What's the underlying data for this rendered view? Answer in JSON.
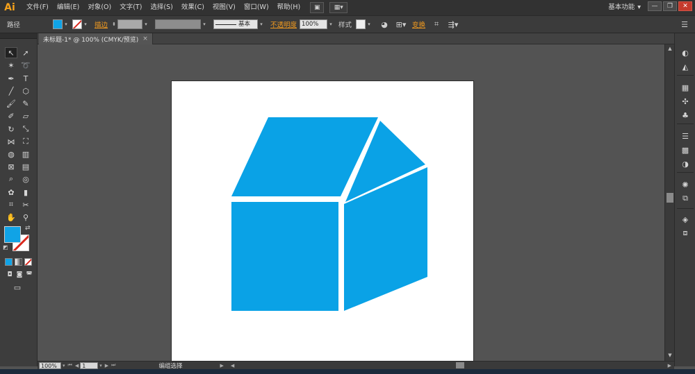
{
  "app": {
    "logo": "Ai"
  },
  "menu": [
    "文件(F)",
    "编辑(E)",
    "对象(O)",
    "文字(T)",
    "选择(S)",
    "效果(C)",
    "视图(V)",
    "窗口(W)",
    "帮助(H)"
  ],
  "workspace": {
    "label": "基本功能",
    "arrow": "▾"
  },
  "window_controls": {
    "minimize": "—",
    "restore": "❐",
    "close": "✕"
  },
  "control_bar": {
    "object_label": "路径",
    "stroke_label": "描边",
    "brush_label": "基本",
    "opacity_label": "不透明度",
    "opacity_value": "100%",
    "style_label": "样式",
    "transform_label": "变换"
  },
  "document_tab": {
    "title": "未标题-1* @ 100% (CMYK/预览)",
    "close": "×"
  },
  "status_bar": {
    "zoom": "100%",
    "artboard_number": "1",
    "status_text": "编组选择"
  },
  "colors": {
    "fill": "#10a3e6",
    "house": "#0aa2e6",
    "accent": "#f7a21b",
    "stroke_none": "#d92a1f"
  },
  "tools": [
    "selection-tool",
    "direct-selection-tool",
    "magic-wand-tool",
    "lasso-tool",
    "pen-tool",
    "type-tool",
    "line-segment-tool",
    "rectangle-tool",
    "paintbrush-tool",
    "pencil-tool",
    "blob-brush-tool",
    "eraser-tool",
    "rotate-tool",
    "scale-tool",
    "width-tool",
    "free-transform-tool",
    "shape-builder-tool",
    "perspective-grid-tool",
    "mesh-tool",
    "gradient-tool",
    "eyedropper-tool",
    "blend-tool",
    "symbol-sprayer-tool",
    "column-graph-tool",
    "artboard-tool",
    "slice-tool",
    "hand-tool",
    "zoom-tool"
  ]
}
